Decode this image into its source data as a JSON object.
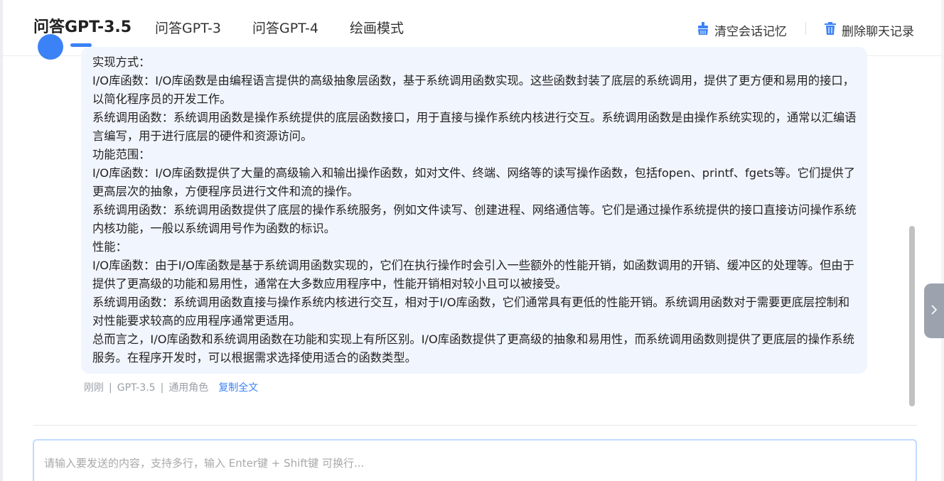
{
  "header": {
    "tabs": [
      {
        "label": "问答GPT-3.5",
        "active": true
      },
      {
        "label": "问答GPT-3",
        "active": false
      },
      {
        "label": "问答GPT-4",
        "active": false
      },
      {
        "label": "绘画模式",
        "active": false
      }
    ],
    "clear_memory_label": "清空会话记忆",
    "delete_history_label": "删除聊天记录",
    "clear_icon": "broom-icon",
    "delete_icon": "trash-icon"
  },
  "message": {
    "paragraphs": [
      "实现方式：",
      "I/O库函数：I/O库函数是由编程语言提供的高级抽象层函数，基于系统调用函数实现。这些函数封装了底层的系统调用，提供了更方便和易用的接口，以简化程序员的开发工作。",
      "系统调用函数：系统调用函数是操作系统提供的底层函数接口，用于直接与操作系统内核进行交互。系统调用函数是由操作系统实现的，通常以汇编语言编写，用于进行底层的硬件和资源访问。",
      "功能范围：",
      "I/O库函数：I/O库函数提供了大量的高级输入和输出操作函数，如对文件、终端、网络等的读写操作函数，包括fopen、printf、fgets等。它们提供了更高层次的抽象，方便程序员进行文件和流的操作。",
      "系统调用函数：系统调用函数提供了底层的操作系统服务，例如文件读写、创建进程、网络通信等。它们是通过操作系统提供的接口直接访问操作系统内核功能，一般以系统调用号作为函数的标识。",
      "性能：",
      "I/O库函数：由于I/O库函数是基于系统调用函数实现的，它们在执行操作时会引入一些额外的性能开销，如函数调用的开销、缓冲区的处理等。但由于提供了更高级的功能和易用性，通常在大多数应用程序中，性能开销相对较小且可以被接受。",
      "系统调用函数：系统调用函数直接与操作系统内核进行交互，相对于I/O库函数，它们通常具有更低的性能开销。系统调用函数对于需要更底层控制和对性能要求较高的应用程序通常更适用。",
      "总而言之，I/O库函数和系统调用函数在功能和实现上有所区别。I/O库函数提供了更高级的抽象和易用性，而系统调用函数则提供了更底层的操作系统服务。在程序开发时，可以根据需求选择使用适合的函数类型。"
    ],
    "meta": {
      "time": "刚刚",
      "model": "GPT-3.5",
      "role": "通用角色",
      "separator": "|",
      "copy_label": "复制全文"
    }
  },
  "input": {
    "placeholder": "请输入要发送的内容，支持多行，输入 Enter键 + Shift键 可换行..."
  },
  "side_toggle_icon": "chevron-right-icon",
  "colors": {
    "accent": "#3b82f6",
    "bubble": "#f1f5fd",
    "input_border": "#bfdbfe"
  }
}
